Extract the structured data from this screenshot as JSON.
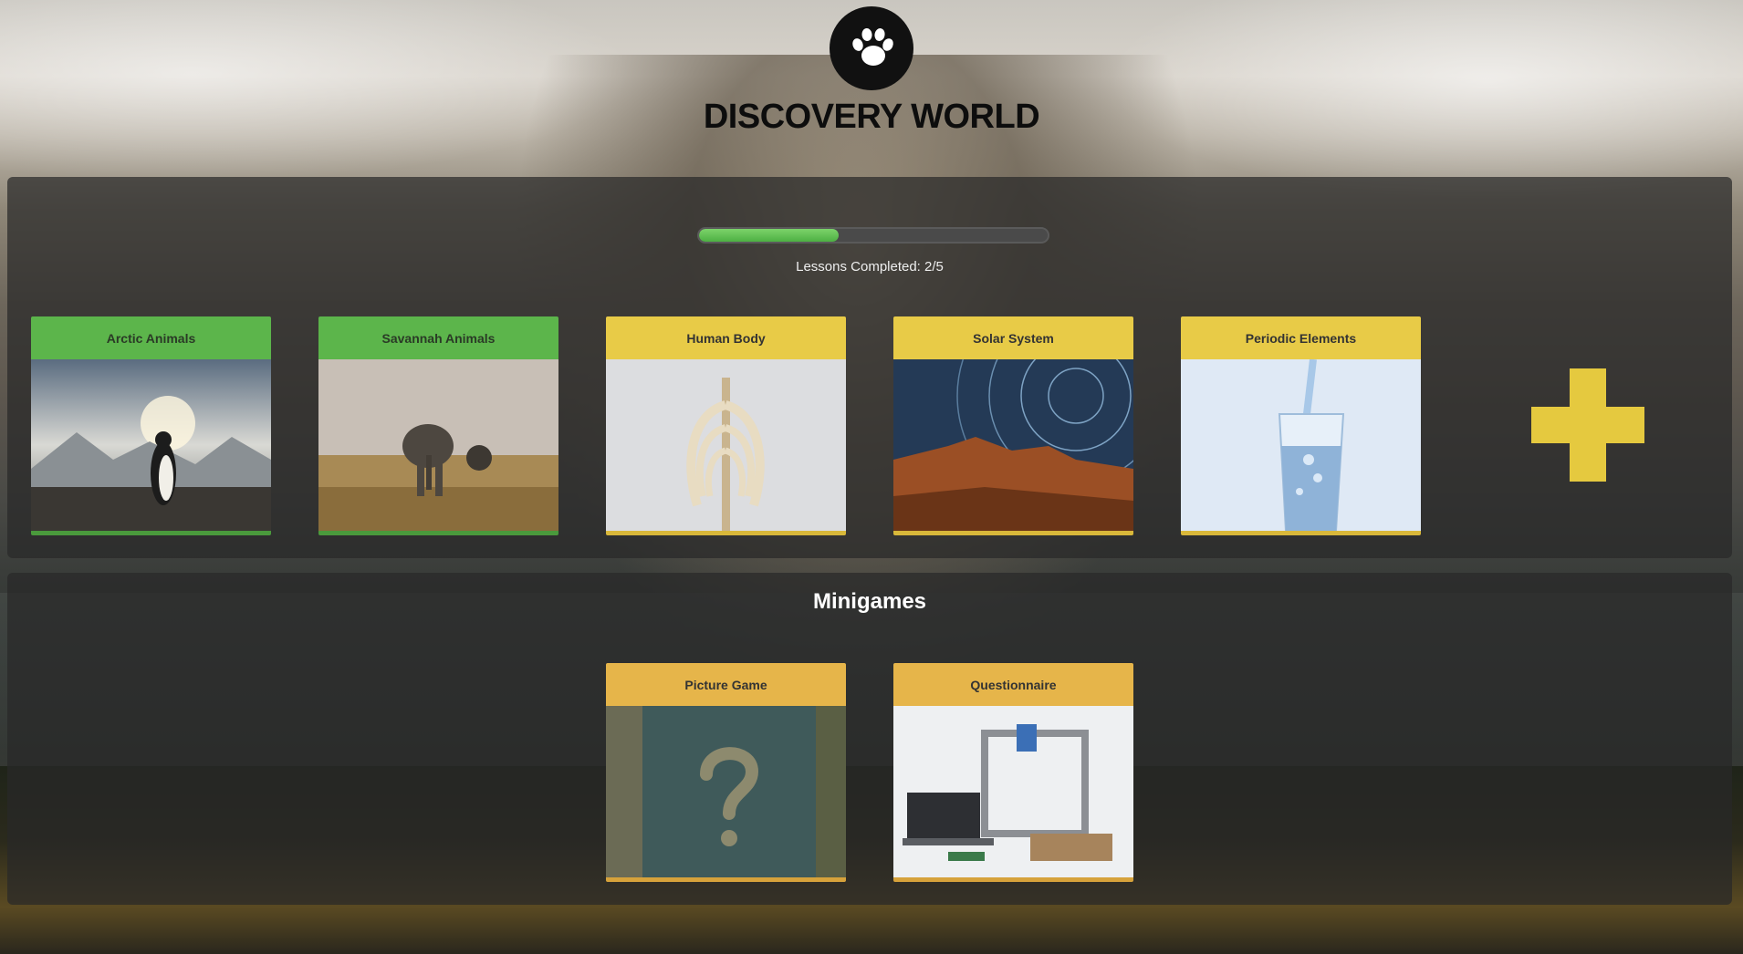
{
  "header": {
    "title": "DISCOVERY WORLD",
    "logo_icon": "paw-icon"
  },
  "progress": {
    "completed": 2,
    "total": 5,
    "label": "Lessons Completed: 2/5"
  },
  "lessons": [
    {
      "title": "Arctic Animals",
      "status": "completed",
      "image": "penguin"
    },
    {
      "title": "Savannah Animals",
      "status": "completed",
      "image": "elephant"
    },
    {
      "title": "Human Body",
      "status": "incomplete",
      "image": "ribcage"
    },
    {
      "title": "Solar System",
      "status": "incomplete",
      "image": "star-trails"
    },
    {
      "title": "Periodic Elements",
      "status": "incomplete",
      "image": "water-glass"
    }
  ],
  "add_button": {
    "icon": "plus-icon"
  },
  "minigames": {
    "title": "Minigames",
    "items": [
      {
        "title": "Picture Game",
        "image": "question-mark-island"
      },
      {
        "title": "Questionnaire",
        "image": "3d-printer"
      }
    ]
  },
  "colors": {
    "completed": "#5cb54b",
    "incomplete": "#e8cb47",
    "minigame": "#e6b54a",
    "progress": "#4db043"
  }
}
